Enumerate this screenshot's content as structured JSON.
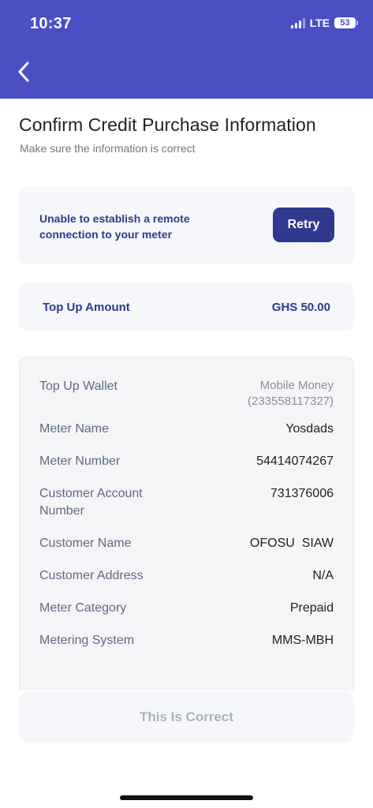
{
  "status_bar": {
    "time": "10:37",
    "network": "LTE",
    "battery": "53"
  },
  "nav": {
    "back_icon": "chevron-left-icon"
  },
  "page": {
    "title": "Confirm Credit Purchase Information",
    "subtitle": "Make sure the information is correct"
  },
  "error_banner": {
    "message": "Unable to establish a remote connection to your meter",
    "retry_label": "Retry"
  },
  "top_up": {
    "label": "Top Up Amount",
    "value": "GHS 50.00"
  },
  "details": {
    "top_up_wallet": {
      "label": "Top Up Wallet",
      "value_line1": "Mobile Money",
      "value_line2": "(233558117327)"
    },
    "meter_name": {
      "label": "Meter Name",
      "value": "Yosdads"
    },
    "meter_number": {
      "label": "Meter Number",
      "value": "54414074267"
    },
    "customer_account_number": {
      "label_line1": "Customer Account",
      "label_line2": "Number",
      "value": "731376006"
    },
    "customer_name": {
      "label": "Customer Name",
      "value": "OFOSU  SIAW"
    },
    "customer_address": {
      "label": "Customer Address",
      "value": "N/A"
    },
    "meter_category": {
      "label": "Meter Category",
      "value": "Prepaid"
    },
    "metering_system": {
      "label": "Metering System",
      "value": "MMS-MBH"
    }
  },
  "confirm_button": {
    "label": "This Is Correct"
  },
  "colors": {
    "header": "#4a4fc4",
    "accent": "#2f3a8f",
    "disabled_text": "#a9b1bf"
  }
}
